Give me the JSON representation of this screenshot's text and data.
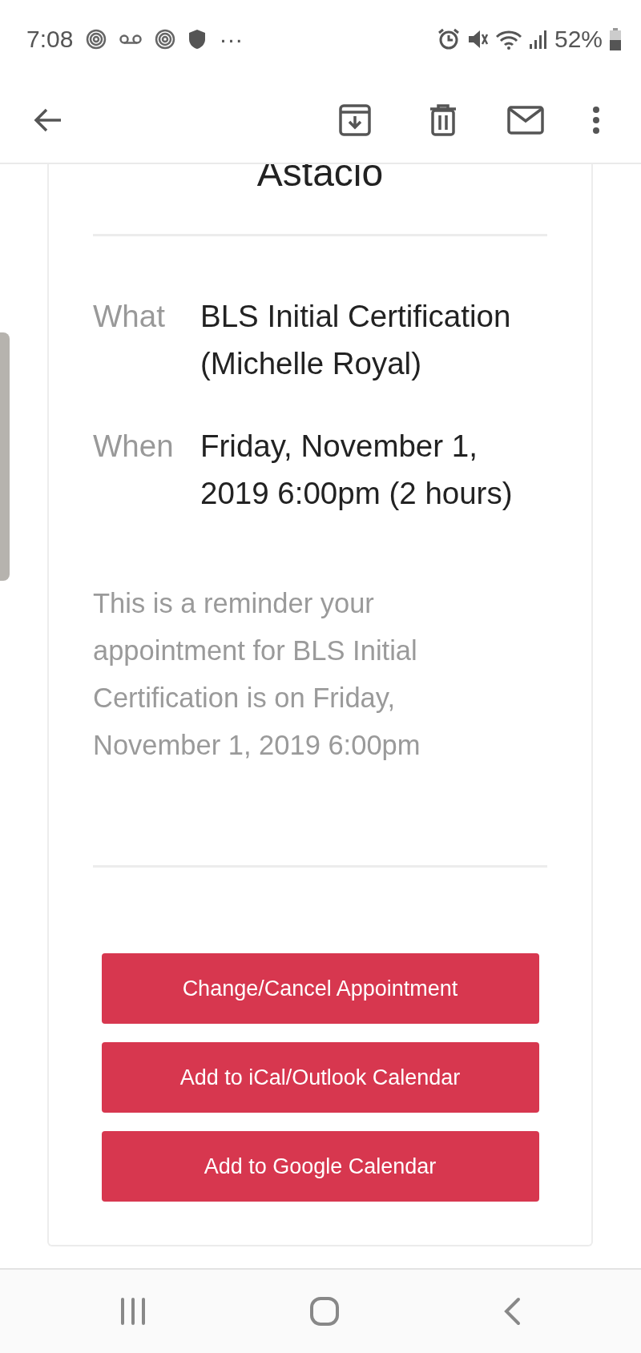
{
  "status_bar": {
    "time": "7:08",
    "more": "···",
    "battery": "52%"
  },
  "header_title": {
    "subtitle_line": "Astacio"
  },
  "details": [
    {
      "label": "What",
      "value": "BLS Initial Certification (Michelle Royal)"
    },
    {
      "label": "When",
      "value": "Friday, November 1, 2019 6:00pm (2 hours)"
    }
  ],
  "message": "This is a reminder your appointment for BLS Initial Certification is on Friday, November 1, 2019 6:00pm",
  "buttons": [
    "Change/Cancel Appointment",
    "Add to iCal/Outlook Calendar",
    "Add to Google Calendar"
  ]
}
